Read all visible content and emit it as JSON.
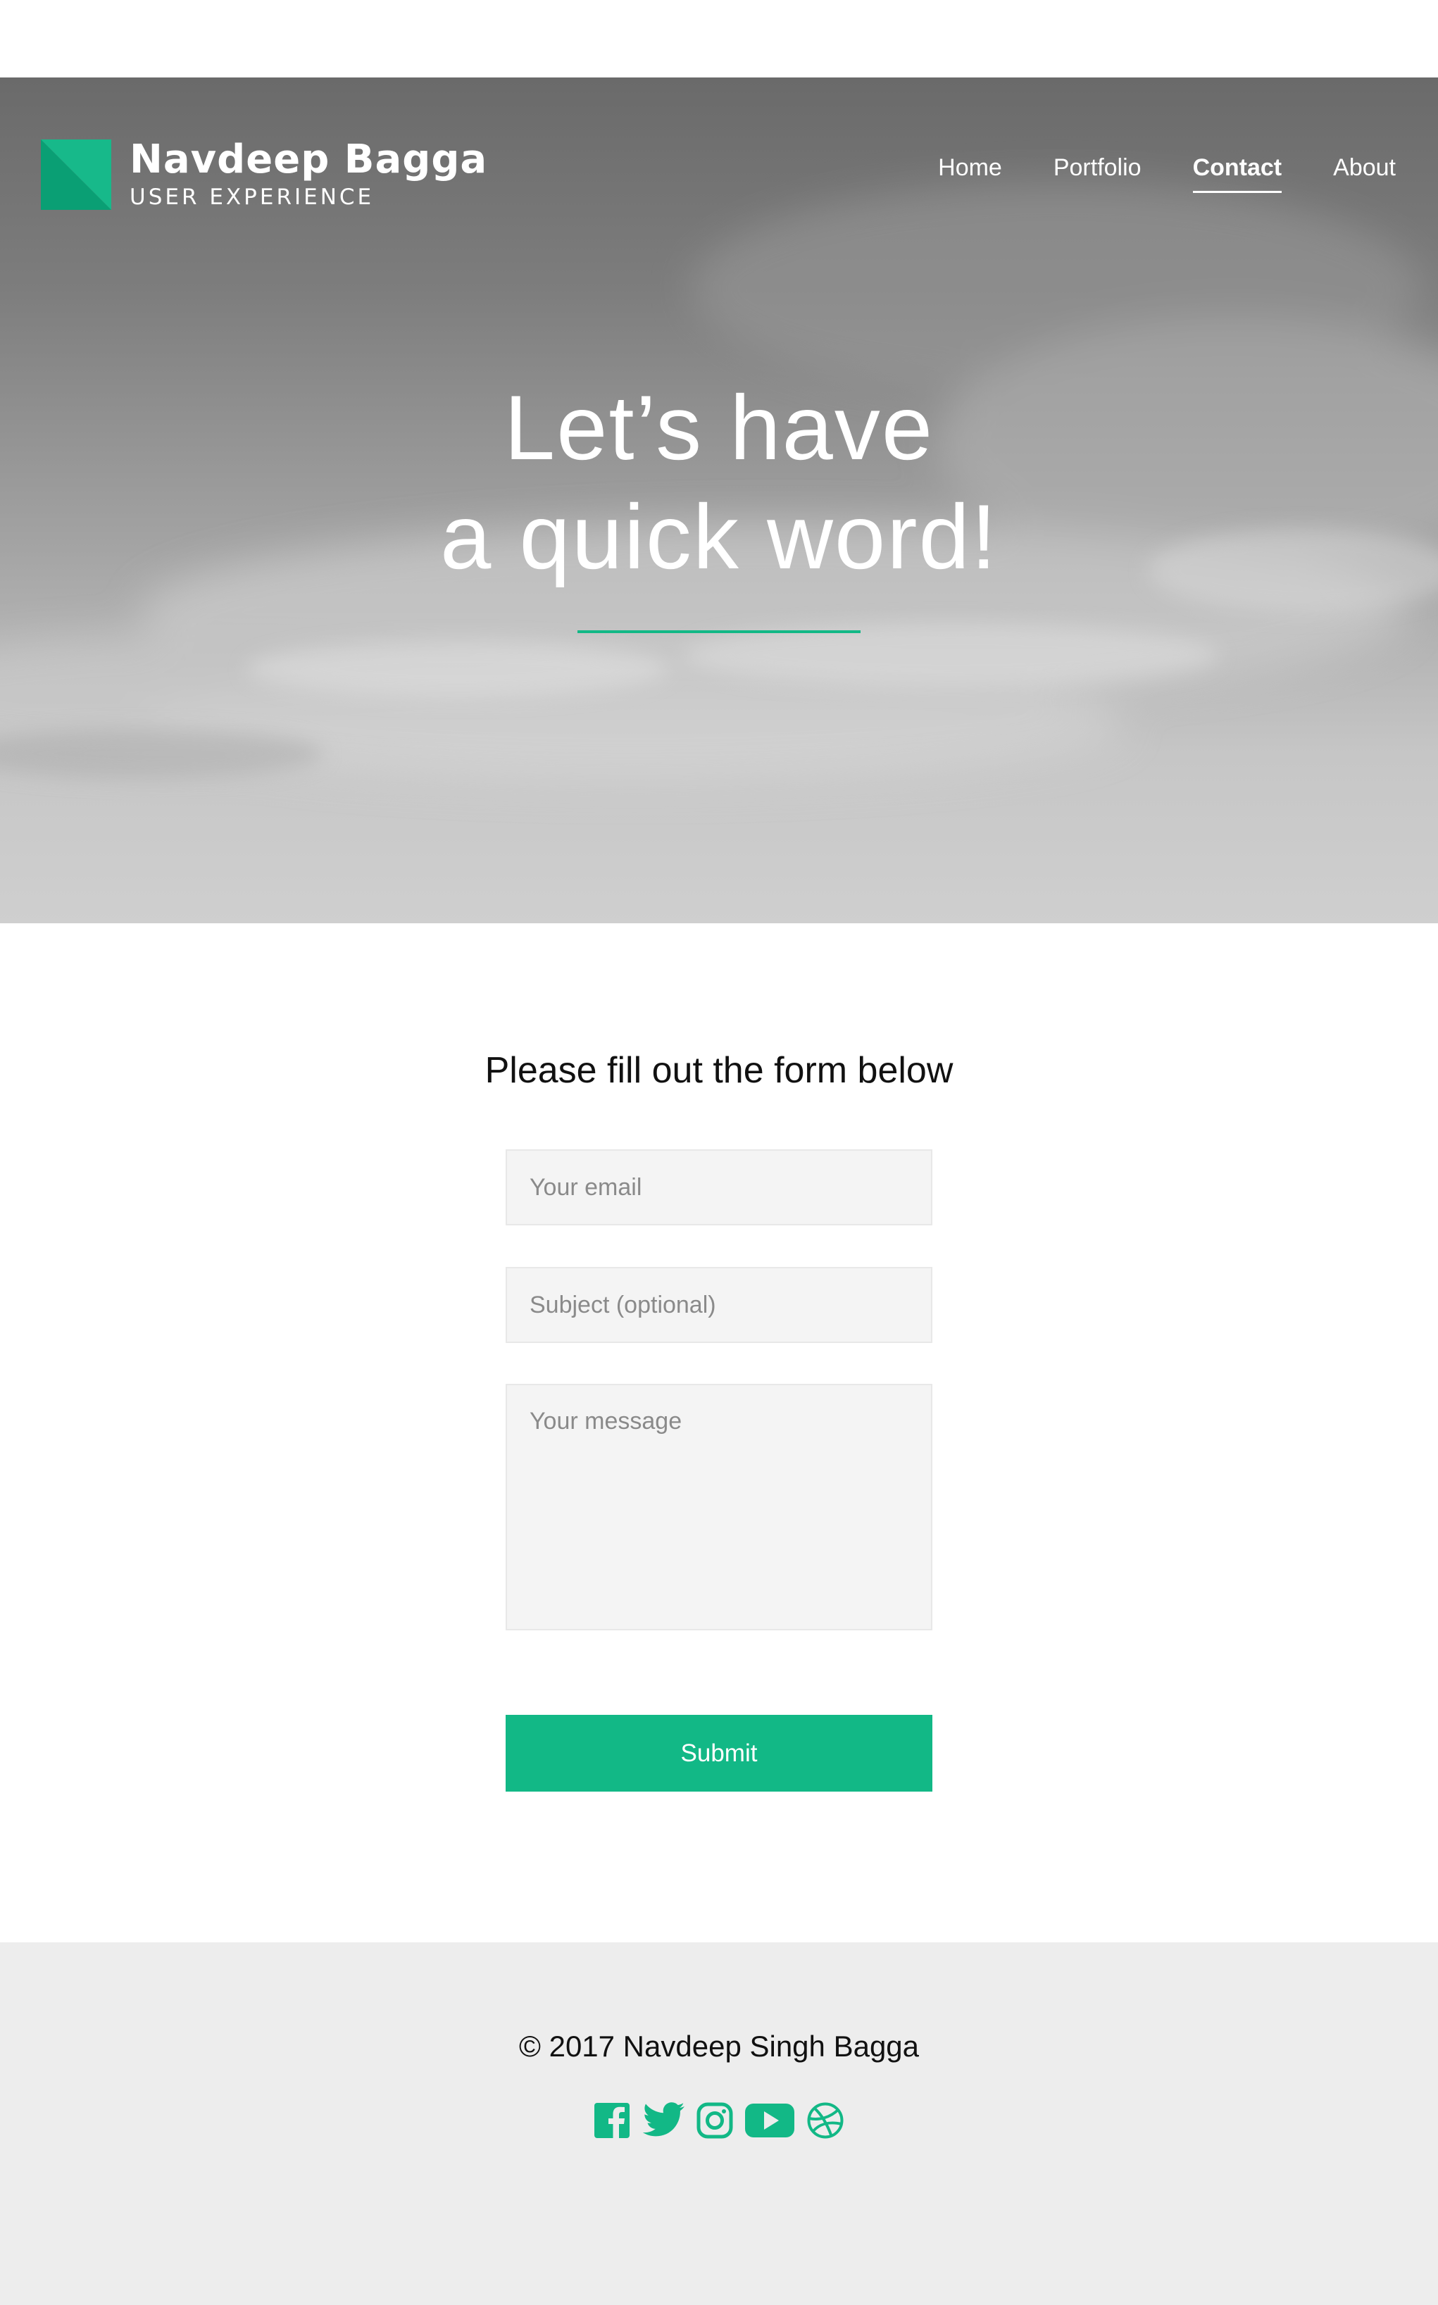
{
  "header": {
    "brand_name": "Navdeep Bagga",
    "brand_tagline": "USER EXPERIENCE",
    "nav": [
      {
        "label": "Home",
        "active": false
      },
      {
        "label": "Portfolio",
        "active": false
      },
      {
        "label": "Contact",
        "active": true
      },
      {
        "label": "About",
        "active": false
      }
    ]
  },
  "hero": {
    "title_line1": "Let’s have",
    "title_line2": "a quick word!"
  },
  "form": {
    "heading": "Please fill out the form below",
    "email_placeholder": "Your email",
    "subject_placeholder": "Subject (optional)",
    "message_placeholder": "Your message",
    "submit_label": "Submit"
  },
  "footer": {
    "copyright": "© 2017 Navdeep Singh Bagga",
    "social": [
      "facebook-icon",
      "twitter-icon",
      "instagram-icon",
      "youtube-icon",
      "dribbble-icon"
    ]
  },
  "colors": {
    "accent": "#12b886",
    "footer_bg": "#ededed",
    "field_bg": "#f4f4f4"
  }
}
